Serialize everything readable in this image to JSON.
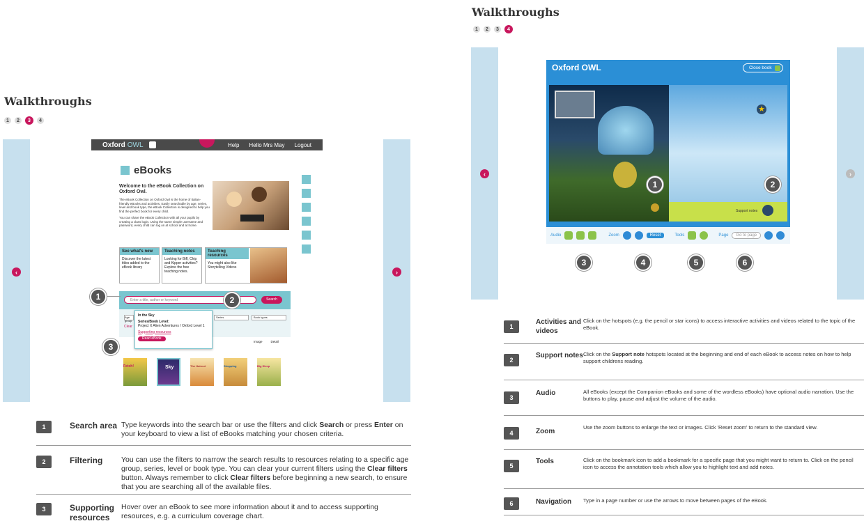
{
  "left": {
    "title": "Walkthroughs",
    "steps": [
      "1",
      "2",
      "3",
      "4"
    ],
    "active_step": 3,
    "topbar": {
      "brand": "Oxford",
      "brand_owl": "OWL",
      "help": "Help",
      "hello": "Hello Mrs May",
      "logout": "Logout"
    },
    "ebooks_title": "eBooks",
    "welcome_heading": "Welcome to the eBook Collection on Oxford Owl.",
    "welcome_p1": "The eBook Collection on Oxford Owl is the home of Italian-friendly eBooks and activities. Easily searchable by age, series, level and book type, the eBook Collection is designed to help you find the perfect book for every child.",
    "welcome_p2": "You can share the eBook Collection with all your pupils by creating a class login. Using the same simple username and password, every child can log on at school and at home.",
    "tiles": [
      {
        "head": "See what's new",
        "body": "Discover the latest titles added to the eBook library"
      },
      {
        "head": "Teaching notes",
        "body": "Looking for Biff, Chip and Kipper activities? Explore the free teaching notes."
      },
      {
        "head": "Teaching resources",
        "body": "You might also like Storytelling Videos"
      }
    ],
    "search_placeholder": "Enter a title, author or keyword",
    "search_button": "Search",
    "filter_age": "Age group",
    "filter_series": "Series",
    "filter_type": "Book types",
    "clear": "Clear",
    "popup": {
      "title": "In the Sky",
      "series_label": "Series/Book Level:",
      "series_value": "Project X Alien Adventures / Oxford Level 1",
      "link": "Supporting resources",
      "button": "Read eBook"
    },
    "view_image": "Image",
    "view_detail": "Detail",
    "book_titles": [
      "Fetch!",
      "Sky",
      "The Haircut",
      "Shopping",
      "Big Sleep"
    ],
    "callouts": [
      "1",
      "2",
      "3"
    ],
    "rows": [
      {
        "num": "1",
        "label": "Search area",
        "desc_pre": "Type keywords into the search bar or use the filters and click ",
        "b1": "Search",
        "desc_mid": " or press ",
        "b2": "Enter",
        "desc_post": " on your keyboard to view a list of eBooks matching your chosen criteria."
      },
      {
        "num": "2",
        "label": "Filtering",
        "desc_pre": "You can use the filters to narrow the search results to resources relating to a specific age group, series, level or book type. You can clear your current filters using the ",
        "b1": "Clear filters",
        "desc_mid": " button. Always remember to click ",
        "b2": "Clear filters",
        "desc_post": " before beginning a new search, to ensure that you are searching all of the available files."
      },
      {
        "num": "3",
        "label": "Supporting resources",
        "desc": "Hover over an eBook to see more information about it and to access supporting resources, e.g. a curriculum coverage chart."
      }
    ]
  },
  "right": {
    "title": "Walkthroughs",
    "steps": [
      "1",
      "2",
      "3",
      "4"
    ],
    "active_step": 4,
    "brand": "Oxford OWL",
    "close_book": "Close book",
    "support_notes": "Support notes",
    "toolbar": {
      "audio": "Audio",
      "zoom": "Zoom",
      "reset": "Reset",
      "tools": "Tools",
      "page": "Page",
      "goto": "Go to page"
    },
    "callouts": [
      "1",
      "2",
      "3",
      "4",
      "5",
      "6"
    ],
    "rows": [
      {
        "num": "1",
        "label": "Activities and videos",
        "desc": "Click on the hotspots (e.g. the pencil or star icons) to access interactive activities and videos related to the topic of the eBook."
      },
      {
        "num": "2",
        "label": "Support notes",
        "desc_pre": "Click on the ",
        "b1": "Support note",
        "desc_post": " hotspots located at the beginning and end of each eBook to access notes on how to help support childrens reading."
      },
      {
        "num": "3",
        "label": "Audio",
        "desc": "All eBooks (except the Companion eBooks and some of the wordless eBooks) have optional audio narration. Use the buttons to play, pause and adjust the volume of the audio."
      },
      {
        "num": "4",
        "label": "Zoom",
        "desc": "Use the zoom buttons to enlarge the text or images. Click 'Reset zoom' to return to the standard view."
      },
      {
        "num": "5",
        "label": "Tools",
        "desc": "Click on the bookmark icon to add a bookmark for a specific page that you might want to return to. Click on the pencil icon to access the annotation tools which allow you to highlight text and add notes."
      },
      {
        "num": "6",
        "label": "Navigation",
        "desc": "Type in a page number or use the arrows to move between pages of the eBook."
      }
    ]
  },
  "colors": {
    "accent": "#c8175d",
    "side": "#c7e0ee",
    "teal": "#7ac5cf",
    "owl_blue": "#2b8fd6",
    "green": "#8bc34a"
  }
}
